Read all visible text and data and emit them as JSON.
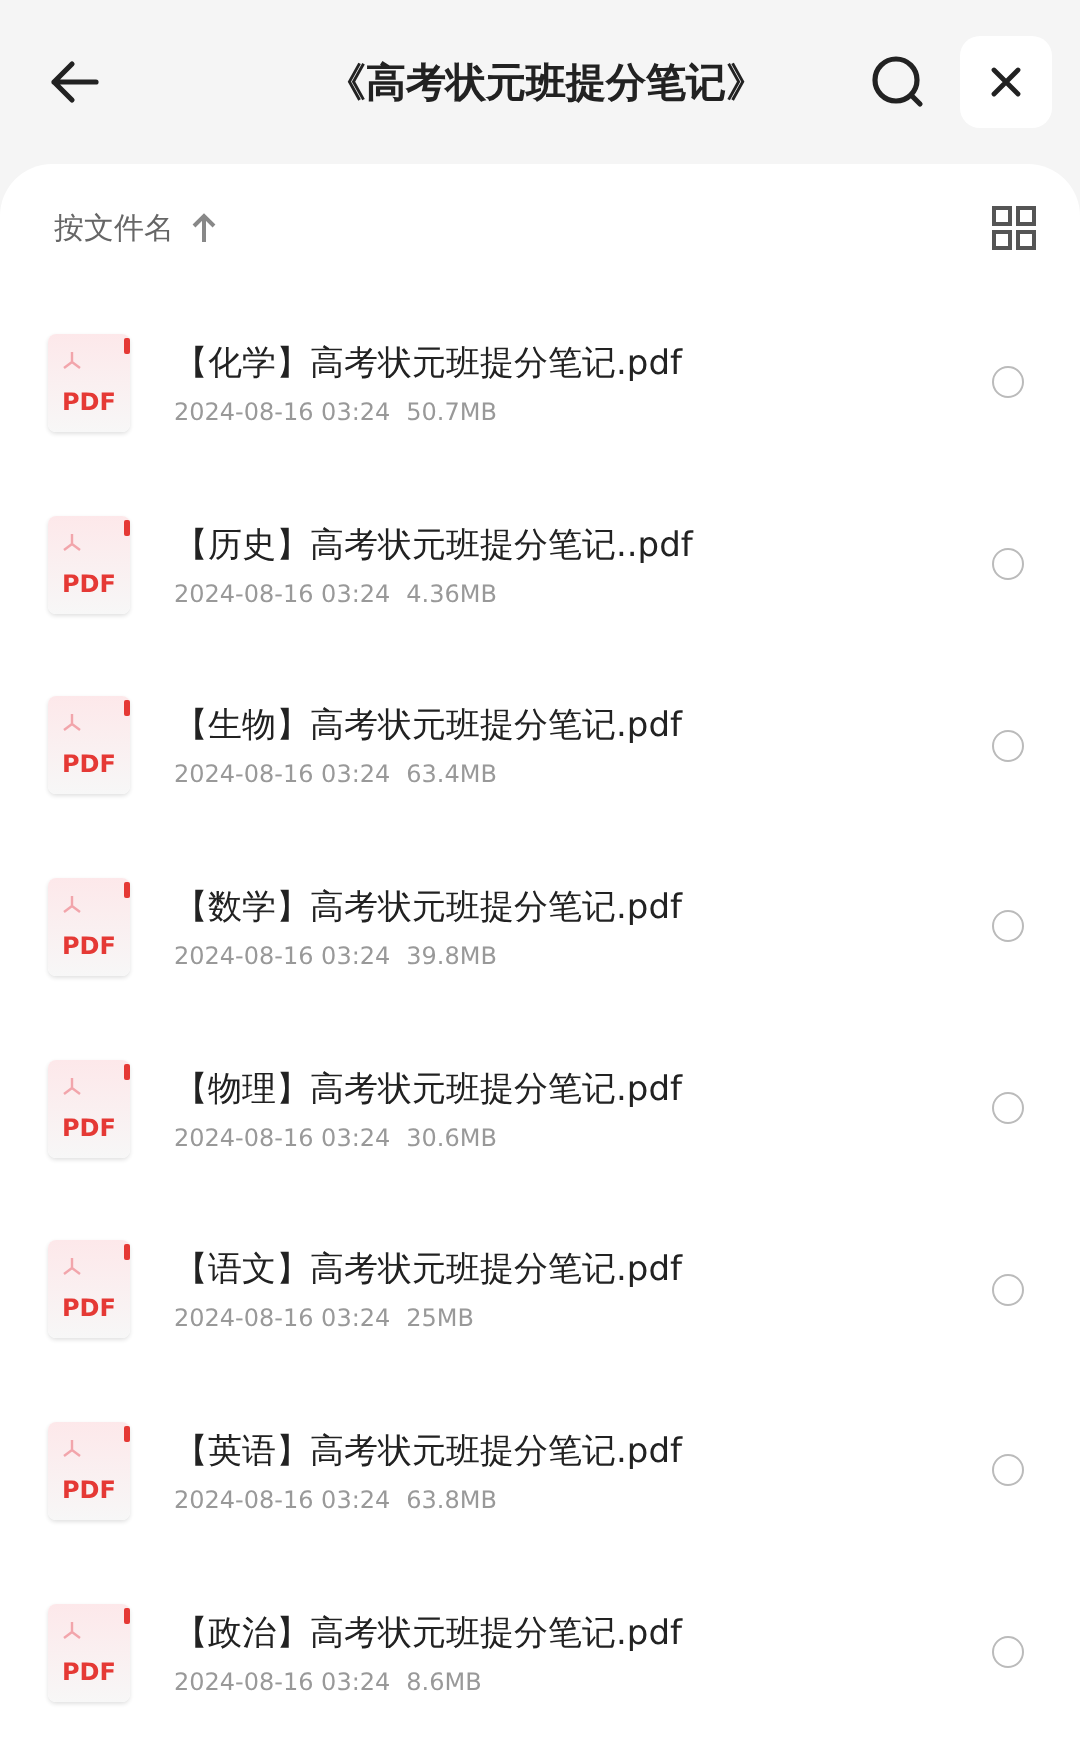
{
  "header": {
    "title": "《高考状元班提分笔记》"
  },
  "sort": {
    "label": "按文件名"
  },
  "files": [
    {
      "icon_label": "PDF",
      "name": "【化学】高考状元班提分笔记.pdf",
      "date": "2024-08-16 03:24",
      "size": "50.7MB",
      "selected": false
    },
    {
      "icon_label": "PDF",
      "name": "【历史】高考状元班提分笔记..pdf",
      "date": "2024-08-16 03:24",
      "size": "4.36MB",
      "selected": false
    },
    {
      "icon_label": "PDF",
      "name": "【生物】高考状元班提分笔记.pdf",
      "date": "2024-08-16 03:24",
      "size": "63.4MB",
      "selected": false
    },
    {
      "icon_label": "PDF",
      "name": "【数学】高考状元班提分笔记.pdf",
      "date": "2024-08-16 03:24",
      "size": "39.8MB",
      "selected": false
    },
    {
      "icon_label": "PDF",
      "name": "【物理】高考状元班提分笔记.pdf",
      "date": "2024-08-16 03:24",
      "size": "30.6MB",
      "selected": false
    },
    {
      "icon_label": "PDF",
      "name": "【语文】高考状元班提分笔记.pdf",
      "date": "2024-08-16 03:24",
      "size": "25MB",
      "selected": false
    },
    {
      "icon_label": "PDF",
      "name": "【英语】高考状元班提分笔记.pdf",
      "date": "2024-08-16 03:24",
      "size": "63.8MB",
      "selected": false
    },
    {
      "icon_label": "PDF",
      "name": "【政治】高考状元班提分笔记.pdf",
      "date": "2024-08-16 03:24",
      "size": "8.6MB",
      "selected": false
    }
  ]
}
